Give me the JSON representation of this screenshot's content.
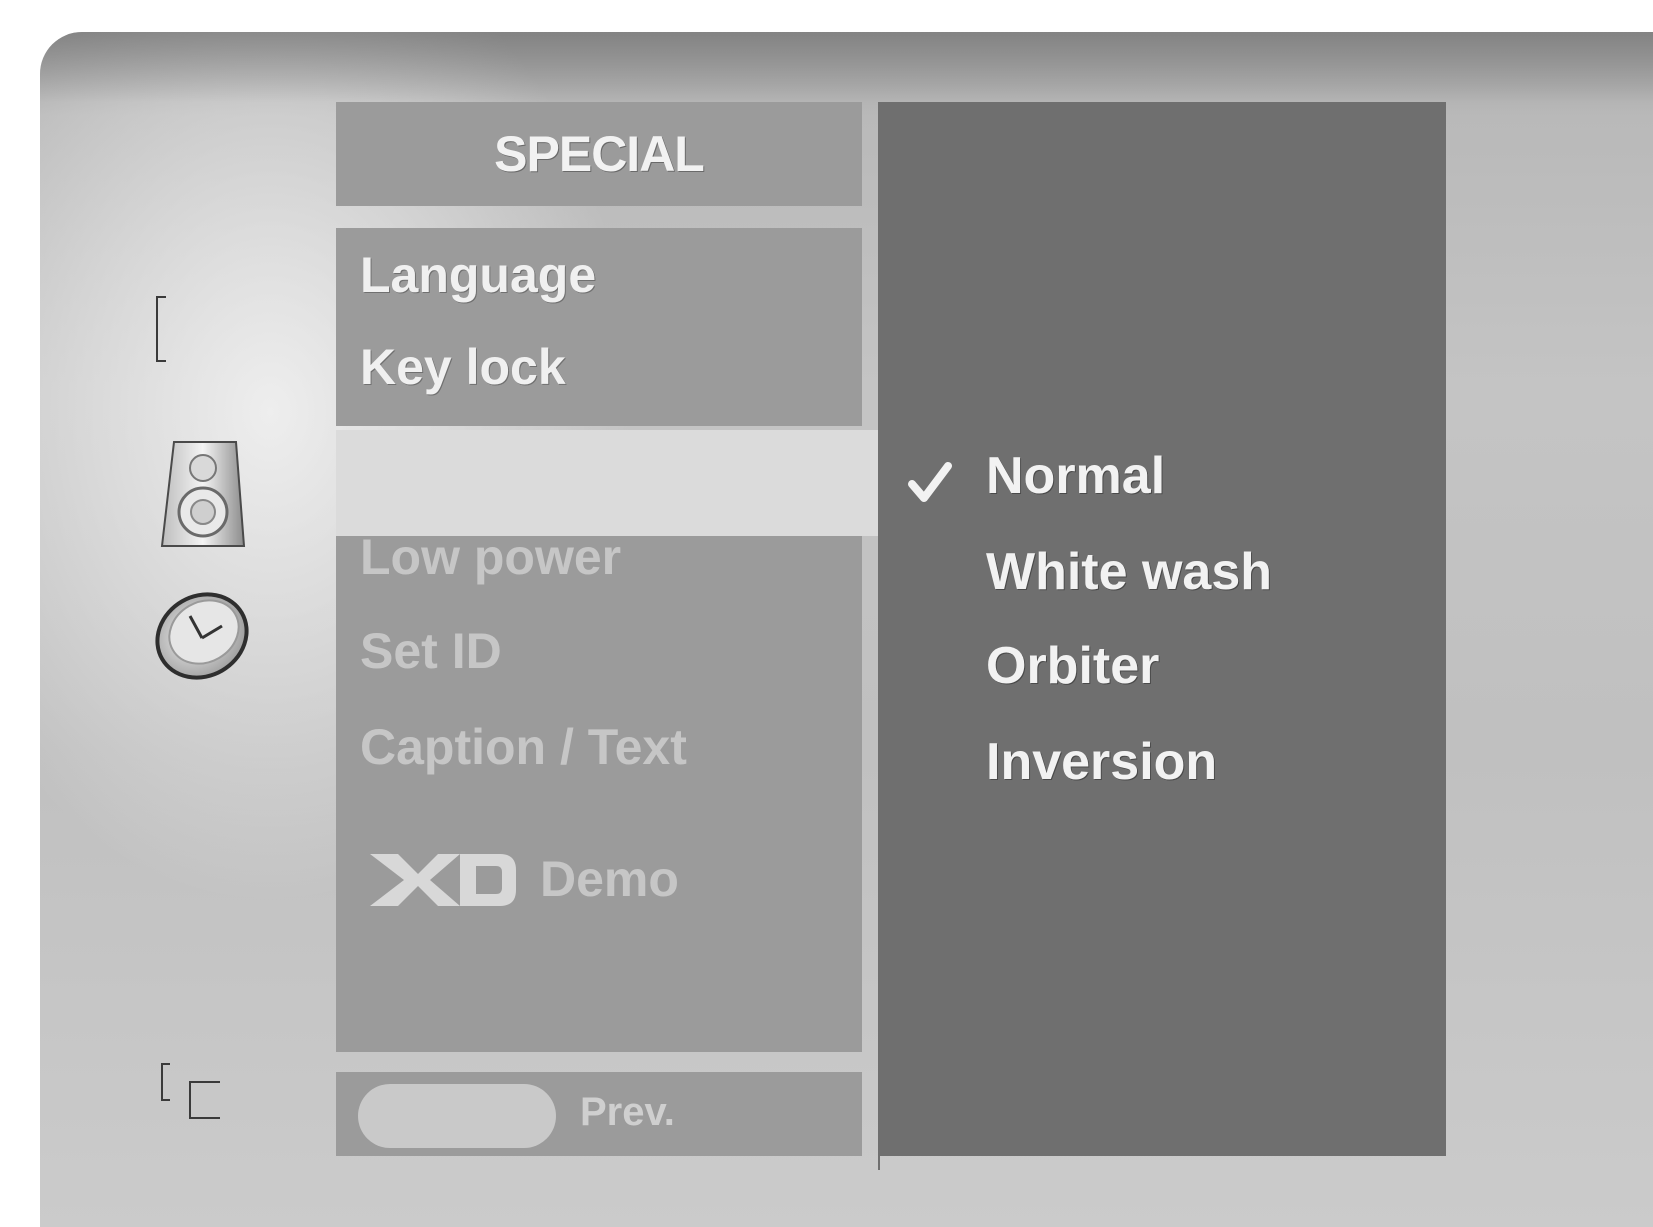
{
  "menu": {
    "title": "SPECIAL",
    "items": [
      {
        "label": "Language",
        "state": "active"
      },
      {
        "label": "Key lock",
        "state": "active"
      },
      {
        "label": "",
        "state": "selected"
      },
      {
        "label": "Low power",
        "state": "dimmed"
      },
      {
        "label": "Set ID",
        "state": "dimmed"
      },
      {
        "label": "Caption / Text",
        "state": "dimmed"
      },
      {
        "label": "Demo",
        "state": "dimmed",
        "logo": "XD"
      }
    ],
    "prev_label": "Prev."
  },
  "submenu": {
    "options": [
      {
        "label": "Normal",
        "checked": true
      },
      {
        "label": "White wash",
        "checked": false
      },
      {
        "label": "Orbiter",
        "checked": false
      },
      {
        "label": "Inversion",
        "checked": false
      }
    ]
  },
  "icons": [
    "bracket-icon",
    "speaker-icon",
    "clock-icon",
    "corner-bracket-icon",
    "check-icon",
    "xd-logo"
  ],
  "colors": {
    "menu_panel": "#9b9b9b",
    "highlight": "#dbdbdb",
    "submenu_panel": "#6f6f6f",
    "text_active": "#f0f0f0",
    "text_dimmed": "#c6c6c6"
  }
}
